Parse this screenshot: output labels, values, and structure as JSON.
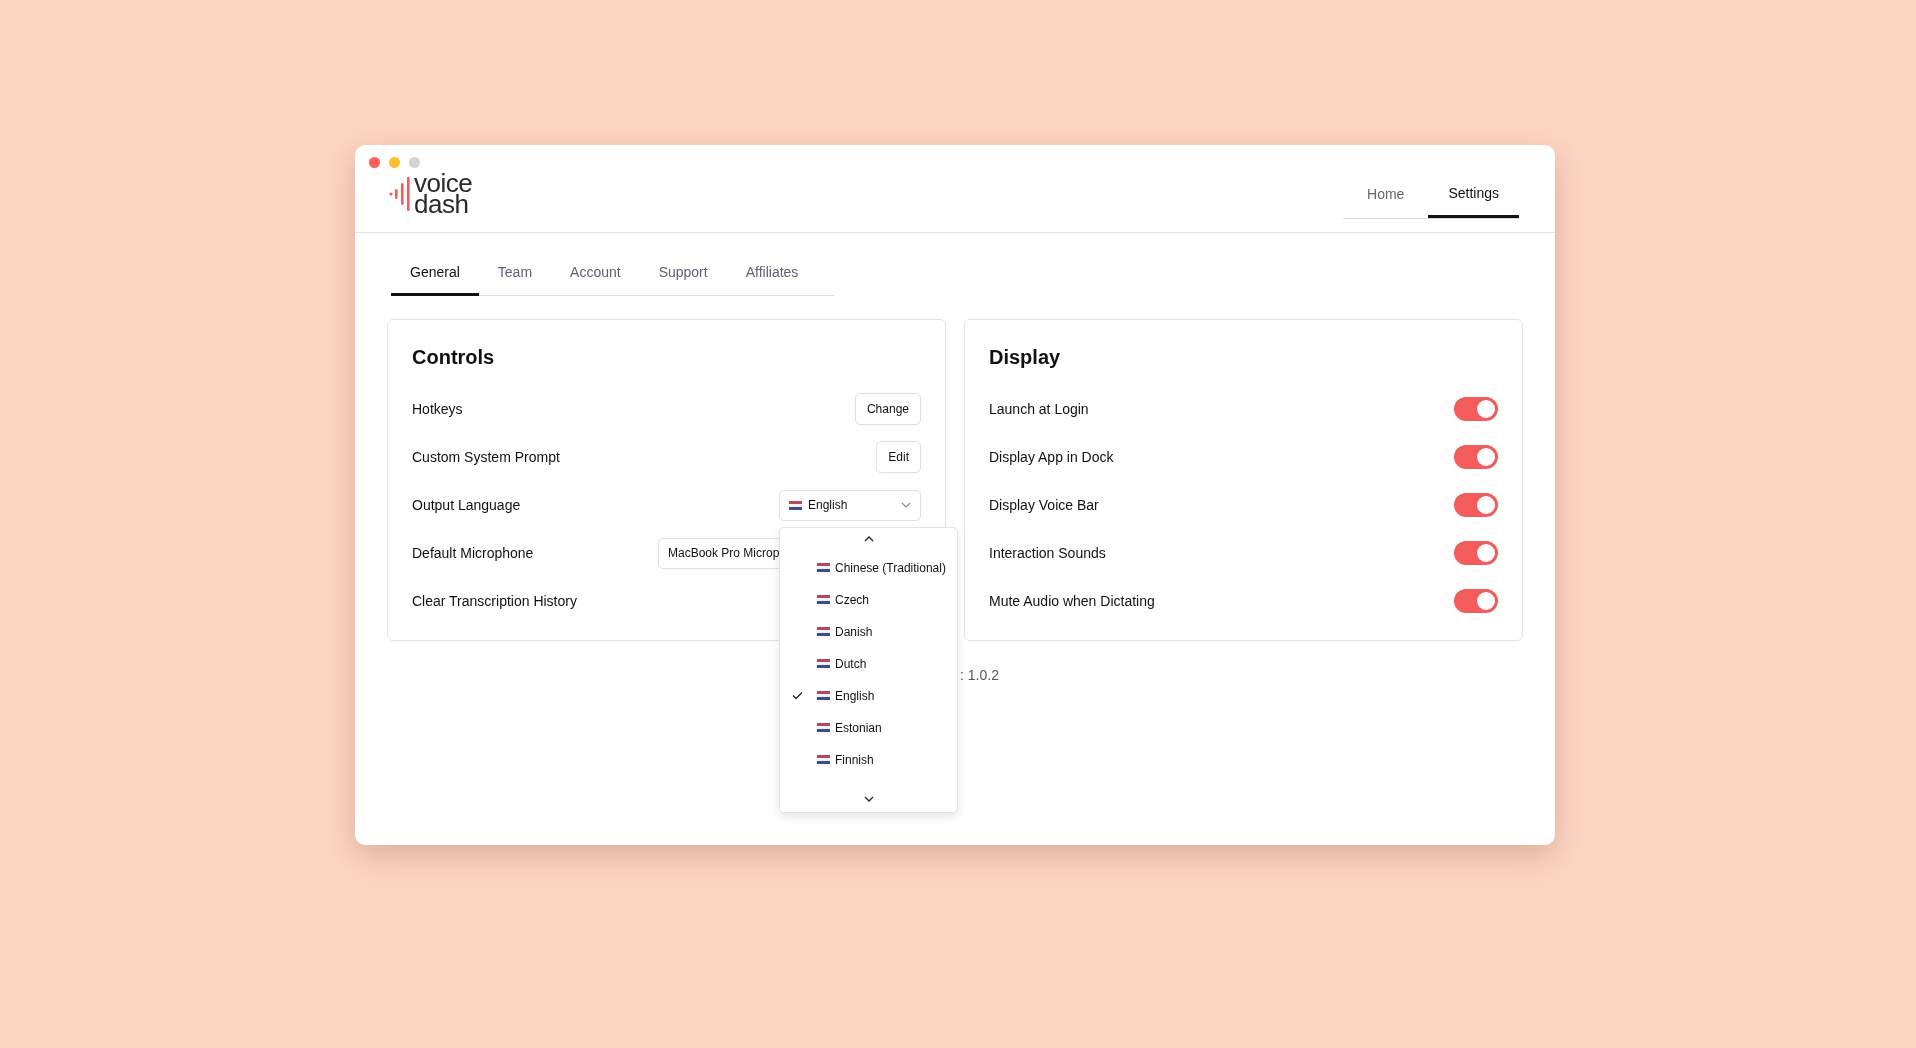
{
  "logo": {
    "line1": "voice",
    "line2": "dash"
  },
  "nav": [
    {
      "label": "Home",
      "selected": false
    },
    {
      "label": "Settings",
      "selected": true
    }
  ],
  "tabs": [
    {
      "label": "General",
      "selected": true
    },
    {
      "label": "Team",
      "selected": false
    },
    {
      "label": "Account",
      "selected": false
    },
    {
      "label": "Support",
      "selected": false
    },
    {
      "label": "Affiliates",
      "selected": false
    }
  ],
  "controls": {
    "title": "Controls",
    "rows": [
      {
        "kind": "button",
        "label": "Hotkeys",
        "button": "Change"
      },
      {
        "kind": "button",
        "label": "Custom System Prompt",
        "button": "Edit"
      },
      {
        "kind": "select",
        "label": "Output Language",
        "value": "English"
      },
      {
        "kind": "field",
        "label": "Default Microphone",
        "value": "MacBook Pro Microp"
      },
      {
        "kind": "plain",
        "label": "Clear Transcription History"
      }
    ]
  },
  "language_menu": {
    "options": [
      {
        "label": "Chinese (Traditional)",
        "selected": false
      },
      {
        "label": "Czech",
        "selected": false
      },
      {
        "label": "Danish",
        "selected": false
      },
      {
        "label": "Dutch",
        "selected": false
      },
      {
        "label": "English",
        "selected": true
      },
      {
        "label": "Estonian",
        "selected": false
      },
      {
        "label": "Finnish",
        "selected": false
      }
    ]
  },
  "display": {
    "title": "Display",
    "items": [
      {
        "label": "Launch at Login",
        "on": true
      },
      {
        "label": "Display App in Dock",
        "on": true
      },
      {
        "label": "Display Voice Bar",
        "on": true
      },
      {
        "label": "Interaction Sounds",
        "on": true
      },
      {
        "label": "Mute Audio when Dictating",
        "on": true
      }
    ]
  },
  "version": ": 1.0.2"
}
